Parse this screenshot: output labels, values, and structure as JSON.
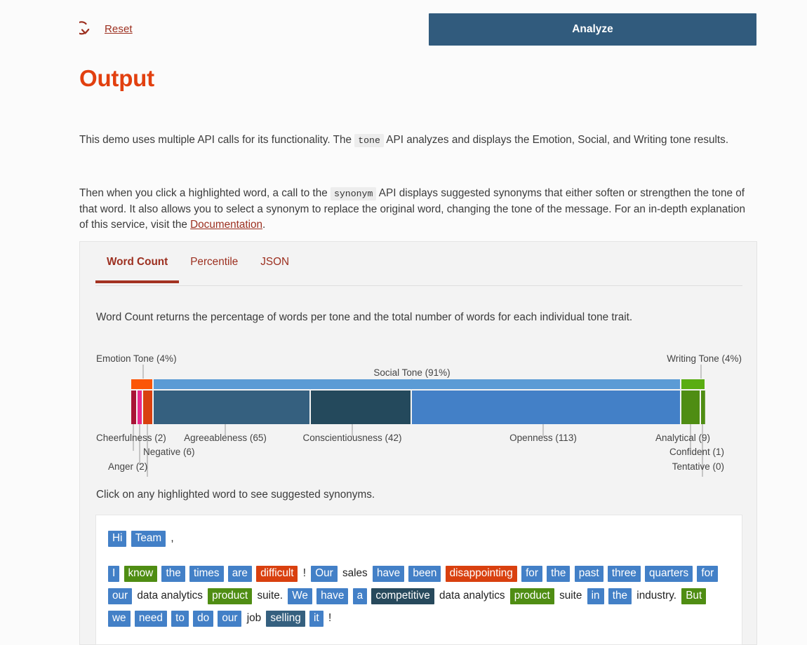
{
  "toolbar": {
    "reset_label": "Reset",
    "reset_icon": "reset-circular-arrow-icon",
    "analyze_label": "Analyze",
    "analyze_color": "#315b7d"
  },
  "page": {
    "title": "Output",
    "title_color": "#e2400f",
    "paragraph1": {
      "before": "This demo uses multiple API calls for its functionality. The",
      "code": "tone",
      "after": "API analyzes and displays the Emotion, Social, and Writing tone results."
    },
    "paragraph2": {
      "before": "Then when you click a highlighted word, a call to the",
      "code": "synonym",
      "middle": "API displays suggested synonyms that either soften or strengthen the tone of that word. It also allows you to select a synonym to replace the original word, changing the tone of the message. For an in-depth explanation of this service, visit the",
      "link": "Documentation",
      "after": "."
    }
  },
  "card": {
    "tabs": [
      {
        "label": "Word Count",
        "active": true
      },
      {
        "label": "Percentile",
        "active": false
      },
      {
        "label": "JSON",
        "active": false
      }
    ],
    "description": "Word Count returns the percentage of words per tone and the total number of words for each individual tone trait.",
    "click_note": "Click on any highlighted word to see suggested synonyms."
  },
  "chart_data": {
    "type": "bar",
    "subtype": "stacked-horizontal-marimekko",
    "title": "",
    "xlabel": "",
    "ylabel": "",
    "groups": [
      {
        "name": "Emotion Tone",
        "label": "Emotion Tone (4%)",
        "percent": 4,
        "label_position": "top-left",
        "color": "#fb5607",
        "segments": [
          {
            "name": "Anger",
            "label": "Anger (2)",
            "value": 2,
            "color": "#a81236",
            "label_position": "bottom"
          },
          {
            "name": "Cheerfulness",
            "label": "Cheerfulness (2)",
            "value": 2,
            "color": "#e8288c",
            "label_position": "bottom"
          },
          {
            "name": "Negative",
            "label": "Negative (6)",
            "value": 6,
            "color": "#d9400f",
            "label_position": "bottom"
          }
        ]
      },
      {
        "name": "Social Tone",
        "label": "Social Tone (91%)",
        "percent": 91,
        "label_position": "top-center",
        "color": "#5b9bd5",
        "segments": [
          {
            "name": "Agreeableness",
            "label": "Agreeableness (65)",
            "value": 65,
            "color": "#35607f",
            "label_position": "bottom"
          },
          {
            "name": "Conscientiousness",
            "label": "Conscientiousness (42)",
            "value": 42,
            "color": "#24495c",
            "label_position": "bottom"
          },
          {
            "name": "Openness",
            "label": "Openness (113)",
            "value": 113,
            "color": "#4380c7",
            "label_position": "bottom"
          }
        ]
      },
      {
        "name": "Writing Tone",
        "label": "Writing Tone (4%)",
        "percent": 4,
        "label_position": "top-right",
        "color": "#5aad12",
        "segments": [
          {
            "name": "Analytical",
            "label": "Analytical (9)",
            "value": 9,
            "color": "#4f8d13",
            "label_position": "bottom"
          },
          {
            "name": "Confident",
            "label": "Confident (1)",
            "value": 1,
            "color": "#4f8d13",
            "label_position": "bottom"
          },
          {
            "name": "Tentative",
            "label": "Tentative (0)",
            "value": 0,
            "color": "#4f8d13",
            "label_position": "bottom"
          }
        ]
      }
    ]
  },
  "message": {
    "greeting": [
      {
        "text": "Hi",
        "tone": "openness"
      },
      {
        "text": "Team",
        "tone": "openness"
      },
      {
        "text": ",",
        "tone": "plain"
      }
    ],
    "body": [
      {
        "text": "I",
        "tone": "openness"
      },
      {
        "text": "know",
        "tone": "analytical"
      },
      {
        "text": "the",
        "tone": "openness"
      },
      {
        "text": "times",
        "tone": "openness"
      },
      {
        "text": "are",
        "tone": "openness"
      },
      {
        "text": "difficult",
        "tone": "anger"
      },
      {
        "text": "!",
        "tone": "plain"
      },
      {
        "text": "Our",
        "tone": "openness"
      },
      {
        "text": "sales",
        "tone": "plain"
      },
      {
        "text": "have",
        "tone": "openness"
      },
      {
        "text": "been",
        "tone": "openness"
      },
      {
        "text": "disappointing",
        "tone": "anger"
      },
      {
        "text": "for",
        "tone": "openness"
      },
      {
        "text": "the",
        "tone": "openness"
      },
      {
        "text": "past",
        "tone": "openness"
      },
      {
        "text": "three",
        "tone": "openness"
      },
      {
        "text": "quarters",
        "tone": "openness"
      },
      {
        "text": "for",
        "tone": "openness"
      },
      {
        "text": "our",
        "tone": "openness"
      },
      {
        "text": "data analytics",
        "tone": "plain"
      },
      {
        "text": "product",
        "tone": "analytical"
      },
      {
        "text": "suite.",
        "tone": "plain"
      },
      {
        "text": "We",
        "tone": "openness"
      },
      {
        "text": "have",
        "tone": "openness"
      },
      {
        "text": "a",
        "tone": "openness"
      },
      {
        "text": "competitive",
        "tone": "conscient"
      },
      {
        "text": "data analytics",
        "tone": "plain"
      },
      {
        "text": "product",
        "tone": "analytical"
      },
      {
        "text": "suite",
        "tone": "plain"
      },
      {
        "text": "in",
        "tone": "openness"
      },
      {
        "text": "the",
        "tone": "openness"
      },
      {
        "text": "industry.",
        "tone": "plain"
      },
      {
        "text": "But",
        "tone": "analytical"
      },
      {
        "text": "we",
        "tone": "openness"
      },
      {
        "text": "need",
        "tone": "openness"
      },
      {
        "text": "to",
        "tone": "openness"
      },
      {
        "text": "do",
        "tone": "openness"
      },
      {
        "text": "our",
        "tone": "openness"
      },
      {
        "text": "job",
        "tone": "plain"
      },
      {
        "text": "selling",
        "tone": "agreeable"
      },
      {
        "text": "it",
        "tone": "openness"
      },
      {
        "text": "!",
        "tone": "plain"
      }
    ]
  }
}
